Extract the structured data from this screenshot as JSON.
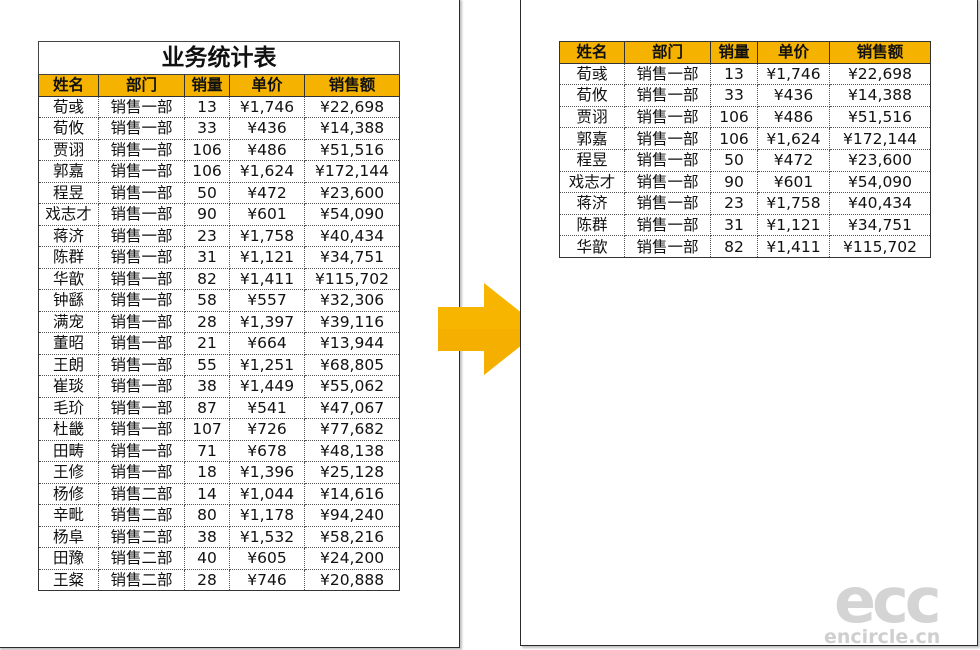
{
  "left_sheet": {
    "title": "业务统计表",
    "headers": [
      "姓名",
      "部门",
      "销量",
      "单价",
      "销售额"
    ],
    "rows": [
      [
        "荀彧",
        "销售一部",
        "13",
        "¥1,746",
        "¥22,698"
      ],
      [
        "荀攸",
        "销售一部",
        "33",
        "¥436",
        "¥14,388"
      ],
      [
        "贾诩",
        "销售一部",
        "106",
        "¥486",
        "¥51,516"
      ],
      [
        "郭嘉",
        "销售一部",
        "106",
        "¥1,624",
        "¥172,144"
      ],
      [
        "程昱",
        "销售一部",
        "50",
        "¥472",
        "¥23,600"
      ],
      [
        "戏志才",
        "销售一部",
        "90",
        "¥601",
        "¥54,090"
      ],
      [
        "蒋济",
        "销售一部",
        "23",
        "¥1,758",
        "¥40,434"
      ],
      [
        "陈群",
        "销售一部",
        "31",
        "¥1,121",
        "¥34,751"
      ],
      [
        "华歆",
        "销售一部",
        "82",
        "¥1,411",
        "¥115,702"
      ],
      [
        "钟繇",
        "销售一部",
        "58",
        "¥557",
        "¥32,306"
      ],
      [
        "满宠",
        "销售一部",
        "28",
        "¥1,397",
        "¥39,116"
      ],
      [
        "董昭",
        "销售一部",
        "21",
        "¥664",
        "¥13,944"
      ],
      [
        "王朗",
        "销售一部",
        "55",
        "¥1,251",
        "¥68,805"
      ],
      [
        "崔琰",
        "销售一部",
        "38",
        "¥1,449",
        "¥55,062"
      ],
      [
        "毛玠",
        "销售一部",
        "87",
        "¥541",
        "¥47,067"
      ],
      [
        "杜畿",
        "销售一部",
        "107",
        "¥726",
        "¥77,682"
      ],
      [
        "田畴",
        "销售一部",
        "71",
        "¥678",
        "¥48,138"
      ],
      [
        "王修",
        "销售一部",
        "18",
        "¥1,396",
        "¥25,128"
      ],
      [
        "杨修",
        "销售二部",
        "14",
        "¥1,044",
        "¥14,616"
      ],
      [
        "辛毗",
        "销售二部",
        "80",
        "¥1,178",
        "¥94,240"
      ],
      [
        "杨阜",
        "销售二部",
        "38",
        "¥1,532",
        "¥58,216"
      ],
      [
        "田豫",
        "销售二部",
        "40",
        "¥605",
        "¥24,200"
      ],
      [
        "王粲",
        "销售二部",
        "28",
        "¥746",
        "¥20,888"
      ]
    ]
  },
  "right_sheet": {
    "headers": [
      "姓名",
      "部门",
      "销量",
      "单价",
      "销售额"
    ],
    "rows": [
      [
        "荀彧",
        "销售一部",
        "13",
        "¥1,746",
        "¥22,698"
      ],
      [
        "荀攸",
        "销售一部",
        "33",
        "¥436",
        "¥14,388"
      ],
      [
        "贾诩",
        "销售一部",
        "106",
        "¥486",
        "¥51,516"
      ],
      [
        "郭嘉",
        "销售一部",
        "106",
        "¥1,624",
        "¥172,144"
      ],
      [
        "程昱",
        "销售一部",
        "50",
        "¥472",
        "¥23,600"
      ],
      [
        "戏志才",
        "销售一部",
        "90",
        "¥601",
        "¥54,090"
      ],
      [
        "蒋济",
        "销售一部",
        "23",
        "¥1,758",
        "¥40,434"
      ],
      [
        "陈群",
        "销售一部",
        "31",
        "¥1,121",
        "¥34,751"
      ],
      [
        "华歆",
        "销售一部",
        "82",
        "¥1,411",
        "¥115,702"
      ]
    ]
  },
  "arrow_color": "#f7b500",
  "header_fill": "#f5b300",
  "watermark": {
    "logo": "ecc",
    "site": "encircle.cn"
  }
}
